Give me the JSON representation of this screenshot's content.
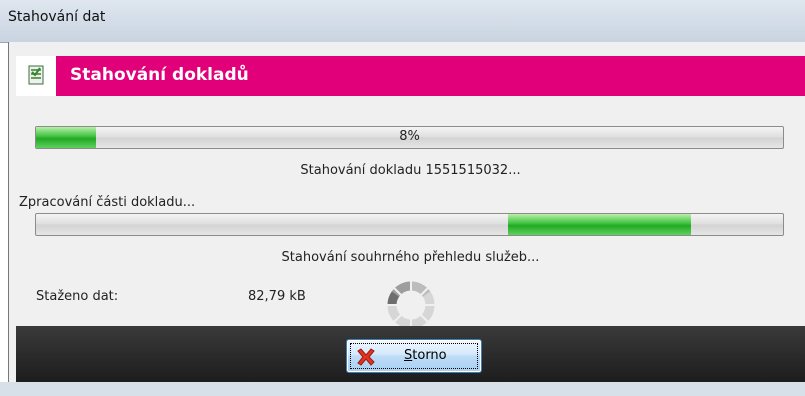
{
  "window": {
    "title": "Stahování dat"
  },
  "banner": {
    "title": "Stahování dokladů",
    "icon": "document-download-icon",
    "color": "#e2007a"
  },
  "main_progress": {
    "label": "8%",
    "fraction": 0.08
  },
  "status_line": "Stahování dokladu 1551515032...",
  "part_label": "Zpracování části dokladu...",
  "part_progress": {
    "mode": "marquee"
  },
  "summary_line": "Stahování souhrného přehledu služeb...",
  "downloaded": {
    "label": "Staženo dat:",
    "value": "82,79 kB"
  },
  "spinner": {
    "icon": "loading-spinner-icon"
  },
  "footer": {
    "cancel_first": "S",
    "cancel_rest": "torno",
    "cancel_icon": "red-x-icon"
  }
}
